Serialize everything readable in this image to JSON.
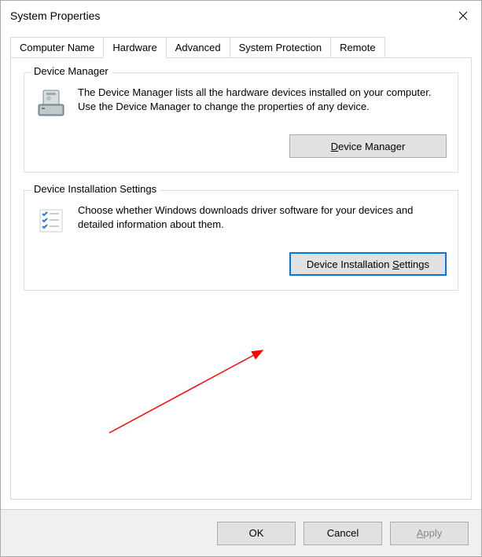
{
  "window": {
    "title": "System Properties"
  },
  "tabs": [
    {
      "label": "Computer Name"
    },
    {
      "label": "Hardware"
    },
    {
      "label": "Advanced"
    },
    {
      "label": "System Protection"
    },
    {
      "label": "Remote"
    }
  ],
  "active_tab_index": 1,
  "group_device_manager": {
    "title": "Device Manager",
    "desc": "The Device Manager lists all the hardware devices installed on your computer. Use the Device Manager to change the properties of any device.",
    "button_prefix": "",
    "button_accel": "D",
    "button_suffix": "evice Manager"
  },
  "group_device_install": {
    "title": "Device Installation Settings",
    "desc": "Choose whether Windows downloads driver software for your devices and detailed information about them.",
    "button_prefix": "Device Installation ",
    "button_accel": "S",
    "button_suffix": "ettings"
  },
  "footer": {
    "ok": "OK",
    "cancel": "Cancel",
    "apply_accel": "A",
    "apply_suffix": "pply"
  }
}
